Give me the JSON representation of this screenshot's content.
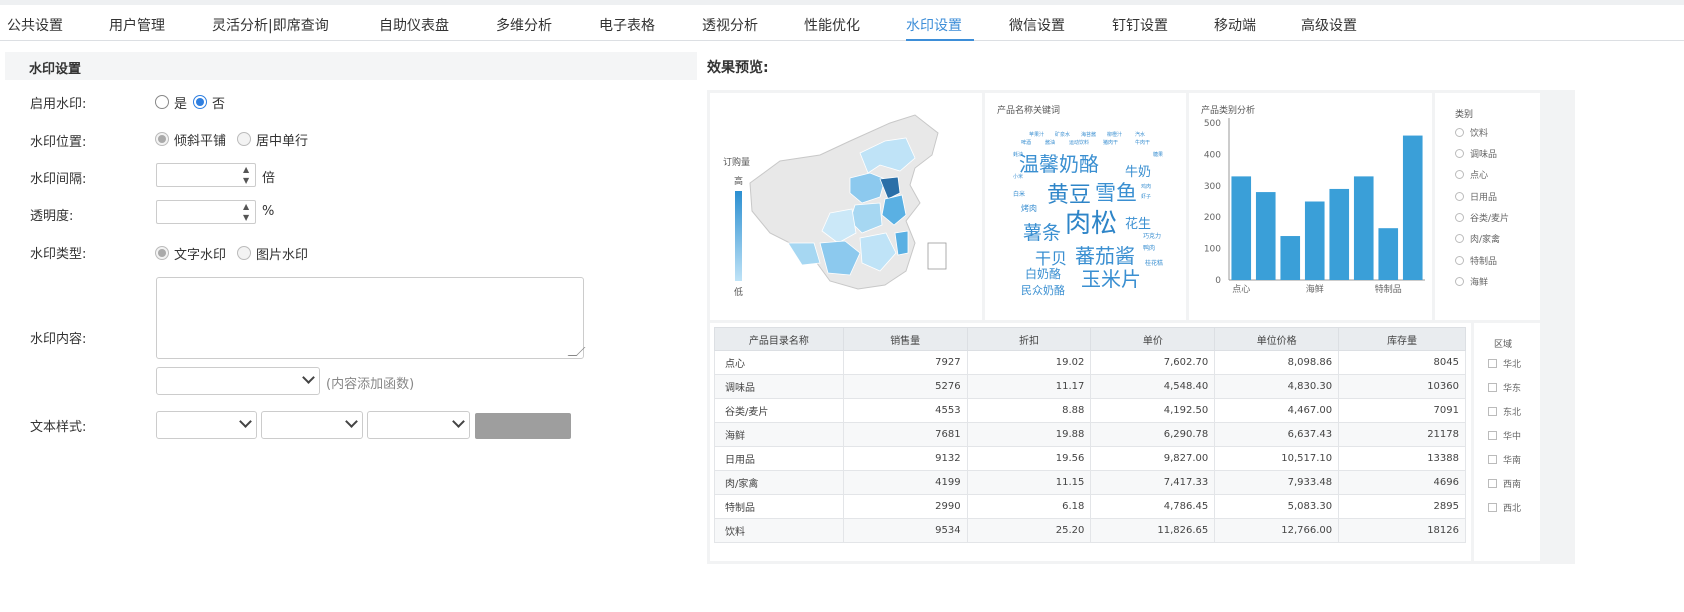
{
  "tabs": [
    {
      "label": "公共设置"
    },
    {
      "label": "用户管理"
    },
    {
      "label": "灵活分析|即席查询"
    },
    {
      "label": "自助仪表盘"
    },
    {
      "label": "多维分析"
    },
    {
      "label": "电子表格"
    },
    {
      "label": "透视分析"
    },
    {
      "label": "性能优化"
    },
    {
      "label": "水印设置",
      "active": true
    },
    {
      "label": "微信设置"
    },
    {
      "label": "钉钉设置"
    },
    {
      "label": "移动端"
    },
    {
      "label": "高级设置"
    }
  ],
  "form": {
    "title": "水印设置",
    "enable": {
      "label": "启用水印:",
      "yes": "是",
      "no": "否",
      "value": "否"
    },
    "position": {
      "label": "水印位置:",
      "opt1": "倾斜平铺",
      "opt2": "居中单行",
      "value": "倾斜平铺"
    },
    "interval": {
      "label": "水印间隔:",
      "unit": "倍",
      "value": ""
    },
    "opacity": {
      "label": "透明度:",
      "unit": "%",
      "value": ""
    },
    "type": {
      "label": "水印类型:",
      "opt1": "文字水印",
      "opt2": "图片水印",
      "value": "文字水印"
    },
    "content": {
      "label": "水印内容:",
      "value": "",
      "func_hint": "(内容添加函数)"
    },
    "text_style": {
      "label": "文本样式:"
    }
  },
  "preview": {
    "title": "效果预览:",
    "map": {
      "legend_title": "订购量",
      "legend_high": "高",
      "legend_low": "低"
    },
    "wordcloud": {
      "title": "产品名称关键词",
      "words_big": [
        "温馨奶酪",
        "黄豆",
        "雪鱼",
        "肉松",
        "薯条",
        "蕃茄酱",
        "玉米片",
        "干贝",
        "白奶酪",
        "民众奶酪",
        "牛奶",
        "花生"
      ],
      "words_small": [
        "烤肉",
        "白米",
        "苹果汁",
        "柳橙汁",
        "汽水",
        "啤酒",
        "酱油",
        "运动饮料",
        "糖果",
        "小米",
        "鸡肉",
        "虾子",
        "巧克力",
        "矿泉水",
        "海苔酱",
        "猪肉干",
        "牛肉干",
        "蚝油",
        "鸭肉",
        "桂花糕"
      ]
    },
    "barchart": {
      "title": "产品类别分析",
      "chart_data": {
        "type": "bar",
        "categories": [
          "点心",
          "调味品",
          "谷类/麦片",
          "海鲜",
          "日用品",
          "肉/家禽",
          "特制品",
          "饮料"
        ],
        "category_labels_shown": [
          "点心",
          "海鲜",
          "特制品"
        ],
        "values": [
          330,
          280,
          140,
          250,
          290,
          330,
          165,
          460
        ],
        "ylim": [
          0,
          500
        ],
        "yticks": [
          0,
          100,
          200,
          300,
          400,
          500
        ],
        "color": "#3a9fd8"
      }
    },
    "category_legend": {
      "title": "类别",
      "items": [
        "饮料",
        "调味品",
        "点心",
        "日用品",
        "谷类/麦片",
        "肉/家禽",
        "特制品",
        "海鲜"
      ]
    },
    "table": {
      "headers": [
        "产品目录名称",
        "销售量",
        "折扣",
        "单价",
        "单位价格",
        "库存量"
      ],
      "rows": [
        [
          "点心",
          "7927",
          "19.02",
          "7,602.70",
          "8,098.86",
          "8045"
        ],
        [
          "调味品",
          "5276",
          "11.17",
          "4,548.40",
          "4,830.30",
          "10360"
        ],
        [
          "谷类/麦片",
          "4553",
          "8.88",
          "4,192.50",
          "4,467.00",
          "7091"
        ],
        [
          "海鲜",
          "7681",
          "19.88",
          "6,290.78",
          "6,637.43",
          "21178"
        ],
        [
          "日用品",
          "9132",
          "19.56",
          "9,827.00",
          "10,517.10",
          "13388"
        ],
        [
          "肉/家禽",
          "4199",
          "11.15",
          "7,417.33",
          "7,933.48",
          "4696"
        ],
        [
          "特制品",
          "2990",
          "6.18",
          "4,786.45",
          "5,083.30",
          "2895"
        ],
        [
          "饮料",
          "9534",
          "25.20",
          "11,826.65",
          "12,766.00",
          "18126"
        ]
      ]
    },
    "region_legend": {
      "title": "区域",
      "items": [
        "华北",
        "华东",
        "东北",
        "华中",
        "华南",
        "西南",
        "西北"
      ]
    }
  }
}
